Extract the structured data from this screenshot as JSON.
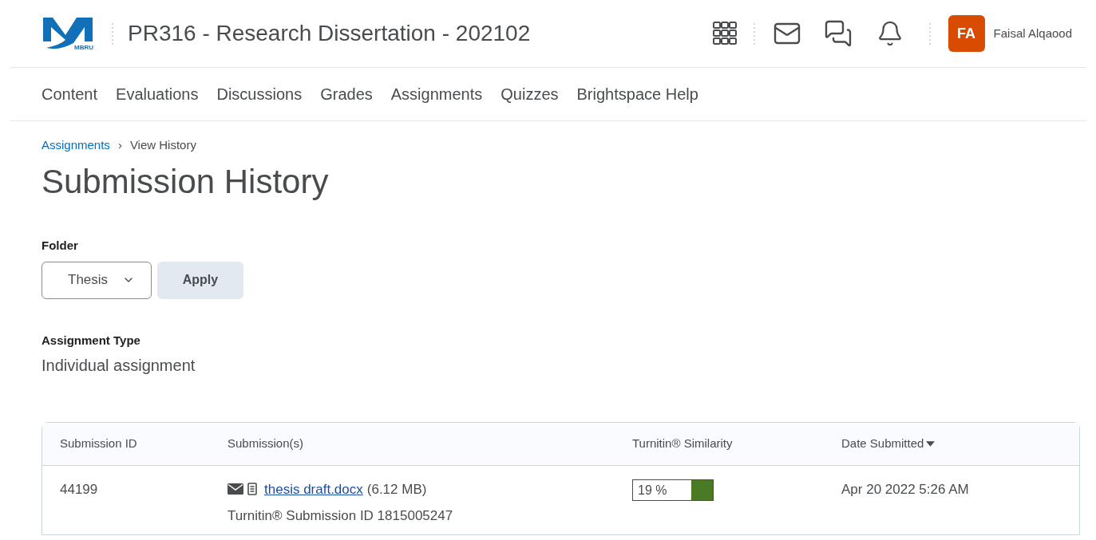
{
  "header": {
    "logo_text": "MBRU",
    "course_title": "PR316 - Research Dissertation - 202102",
    "user": {
      "initials": "FA",
      "name": "Faisal Alqaood"
    }
  },
  "nav": [
    "Content",
    "Evaluations",
    "Discussions",
    "Grades",
    "Assignments",
    "Quizzes",
    "Brightspace Help"
  ],
  "breadcrumb": {
    "link": "Assignments",
    "separator": "›",
    "current": "View History"
  },
  "page_title": "Submission History",
  "folder": {
    "label": "Folder",
    "value": "Thesis",
    "apply": "Apply"
  },
  "assignment_type": {
    "label": "Assignment Type",
    "value": "Individual assignment"
  },
  "table": {
    "columns": [
      "Submission ID",
      "Submission(s)",
      "Turnitin® Similarity",
      "Date Submitted"
    ],
    "rows": [
      {
        "id": "44199",
        "file": "thesis draft.docx",
        "size": "(6.12 MB)",
        "turnitin_id": "Turnitin® Submission ID 1815005247",
        "similarity": "19 %",
        "color": "#4a7a23",
        "date": "Apr 20 2022 5:26 AM"
      }
    ]
  }
}
